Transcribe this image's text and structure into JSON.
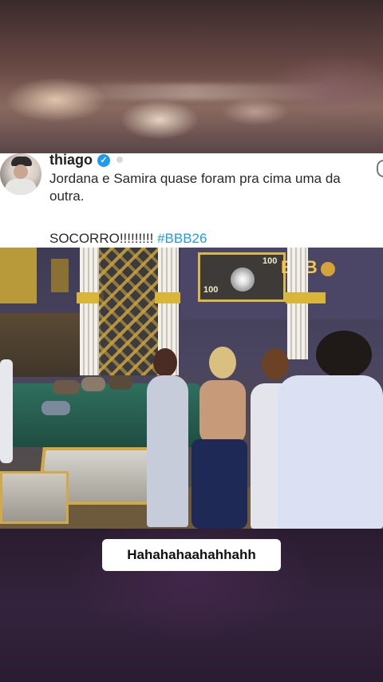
{
  "tweet": {
    "author_name": "thiago",
    "verified_glyph": "✓",
    "text_line1": "Jordana e Samira quase foram pra cima uma da outra.",
    "text_line2_prefix": "SOCORRO!!!!!!!!! ",
    "hashtag": "#BBB26"
  },
  "video": {
    "sign_number_top": "100",
    "sign_number_bottom": "100",
    "brand_text": "BBB"
  },
  "caption": {
    "text": "Hahahahaahahhahh"
  },
  "colors": {
    "hashtag": "#1d9bf0",
    "verified": "#1d9bf0",
    "caption_bg": "#ffffff"
  },
  "icons": [
    "verified-badge-icon",
    "more-options-icon"
  ]
}
